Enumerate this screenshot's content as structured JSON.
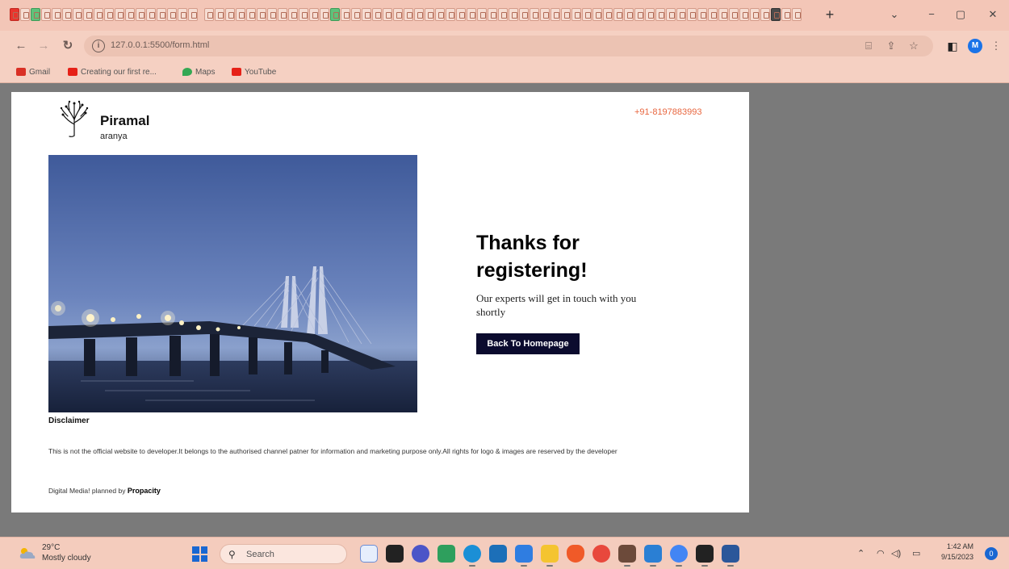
{
  "browser": {
    "tabs_count_shown": 0,
    "new_tab_label": "+",
    "window_controls": {
      "dropdown": "⌄",
      "minimize": "−",
      "maximize": "▢",
      "close": "✕"
    },
    "url": "127.0.0.1:5500/form.html",
    "bookmarks": [
      {
        "label": "Gmail",
        "icon": "gmail-icon",
        "color": "#d93025"
      },
      {
        "label": "Creating our first re...",
        "icon": "youtube-icon",
        "color": "#e62117"
      },
      {
        "label": "Maps",
        "icon": "maps-icon",
        "color": "#34a853"
      },
      {
        "label": "YouTube",
        "icon": "youtube-icon",
        "color": "#e62117"
      }
    ],
    "profile_initial": "M"
  },
  "page": {
    "brand_name": "Piramal",
    "brand_sub": "aranya",
    "phone": "+91-8197883993",
    "thanks_title": "Thanks for registering!",
    "thanks_subtitle": "Our experts will get in touch with you shortly",
    "back_button": "Back To Homepage",
    "disclaimer_heading": "Disclaimer",
    "disclaimer_text": "This is not the official website to developer.It belongs to the authorised channel patner for information and marketing purpose only.All rights for logo & images are reserved by the developer",
    "digital_prefix": "Digital Media! planned by",
    "digital_brand": "Propacity",
    "accent_color": "#e8663f",
    "button_color": "#0b0b2e"
  },
  "taskbar": {
    "weather_temp": "29°C",
    "weather_desc": "Mostly cloudy",
    "search_placeholder": "Search",
    "clock_time": "1:42 AM",
    "clock_date": "9/15/2023",
    "notification_count": "0"
  }
}
